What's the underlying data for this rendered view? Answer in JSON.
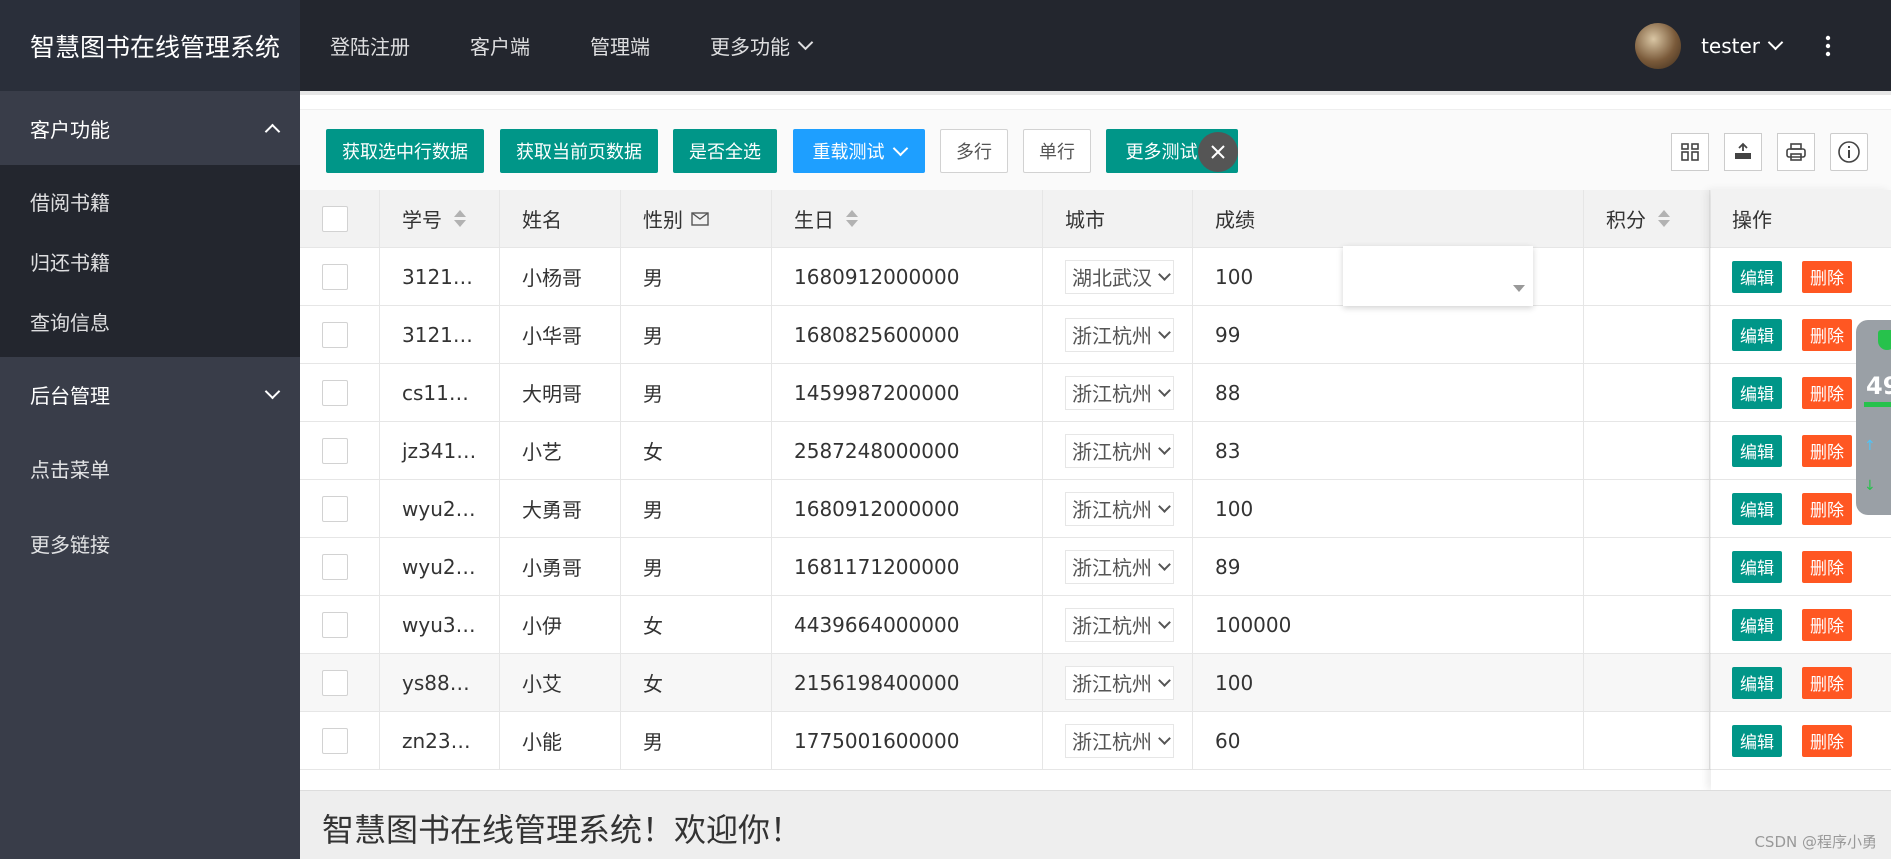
{
  "app": {
    "title": "智慧图书在线管理系统"
  },
  "topnav": {
    "items": [
      {
        "label": "登陆注册"
      },
      {
        "label": "客户端"
      },
      {
        "label": "管理端"
      },
      {
        "label": "更多功能"
      }
    ]
  },
  "user": {
    "name": "tester",
    "menu_icon": "more-vertical-icon"
  },
  "sidebar": {
    "groups": [
      {
        "label": "客户功能",
        "expanded": true,
        "children": [
          "借阅书籍",
          "归还书籍",
          "查询信息"
        ]
      },
      {
        "label": "后台管理",
        "expanded": false
      }
    ],
    "items": [
      "点击菜单",
      "更多链接"
    ]
  },
  "toolbar": {
    "buttons": {
      "get_checked": "获取选中行数据",
      "get_page": "获取当前页数据",
      "is_all": "是否全选",
      "reload": "重载测试",
      "multi": "多行",
      "single": "单行",
      "more": "更多测试"
    },
    "tool_icons": [
      "columns-icon",
      "export-icon",
      "print-icon",
      "info-icon"
    ]
  },
  "table": {
    "columns": [
      "学号",
      "姓名",
      "性别",
      "生日",
      "城市",
      "成绩",
      "积分",
      "操作"
    ],
    "actions": {
      "edit": "编辑",
      "delete": "删除"
    },
    "rows": [
      {
        "id": "3121…",
        "name": "小杨哥",
        "gender": "男",
        "birthday": "1680912000000",
        "city": "湖北武汉",
        "score": "100",
        "points": ""
      },
      {
        "id": "3121…",
        "name": "小华哥",
        "gender": "男",
        "birthday": "1680825600000",
        "city": "浙江杭州",
        "score": "99",
        "points": ""
      },
      {
        "id": "cs11…",
        "name": "大明哥",
        "gender": "男",
        "birthday": "1459987200000",
        "city": "浙江杭州",
        "score": "88",
        "points": ""
      },
      {
        "id": "jz341…",
        "name": "小艺",
        "gender": "女",
        "birthday": "2587248000000",
        "city": "浙江杭州",
        "score": "83",
        "points": ""
      },
      {
        "id": "wyu2…",
        "name": "大勇哥",
        "gender": "男",
        "birthday": "1680912000000",
        "city": "浙江杭州",
        "score": "100",
        "points": ""
      },
      {
        "id": "wyu2…",
        "name": "小勇哥",
        "gender": "男",
        "birthday": "1681171200000",
        "city": "浙江杭州",
        "score": "89",
        "points": ""
      },
      {
        "id": "wyu3…",
        "name": "小伊",
        "gender": "女",
        "birthday": "4439664000000",
        "city": "浙江杭州",
        "score": "100000",
        "points": ""
      },
      {
        "id": "ys88…",
        "name": "小艾",
        "gender": "女",
        "birthday": "2156198400000",
        "city": "浙江杭州",
        "score": "100",
        "points": ""
      },
      {
        "id": "zn23…",
        "name": "小能",
        "gender": "男",
        "birthday": "1775001600000",
        "city": "浙江杭州",
        "score": "60",
        "points": ""
      }
    ]
  },
  "popup": {
    "close_icon": "close-icon"
  },
  "widget": {
    "value": "49"
  },
  "footer": {
    "message": "智慧图书在线管理系统！欢迎你！",
    "watermark": "CSDN @程序小勇"
  },
  "colors": {
    "header": "#23262e",
    "sidebar": "#393d49",
    "primary_green": "#009688",
    "primary_blue": "#1e9fff",
    "danger": "#ff5722"
  }
}
